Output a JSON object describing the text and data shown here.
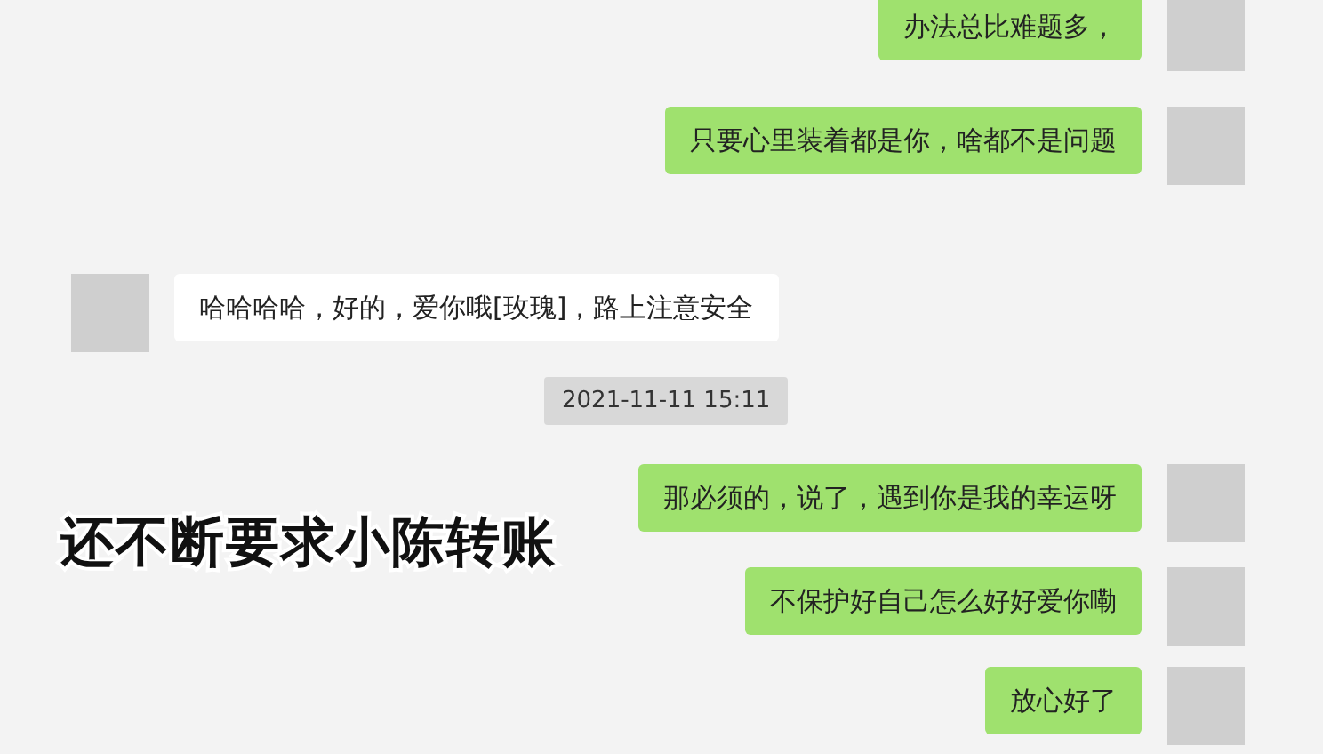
{
  "messages": [
    {
      "kind": "sent",
      "text": "办法总比难题多，"
    },
    {
      "kind": "sent",
      "text": "只要心里装着都是你，啥都不是问题"
    },
    {
      "kind": "received",
      "text": "哈哈哈哈，好的，爱你哦[玫瑰]，路上注意安全"
    },
    {
      "kind": "time",
      "text": "2021-11-11 15:11"
    },
    {
      "kind": "sent",
      "text": "那必须的，说了，遇到你是我的幸运呀"
    },
    {
      "kind": "sent",
      "text": "不保护好自己怎么好好爱你嘞"
    },
    {
      "kind": "sent",
      "text": "放心好了"
    }
  ],
  "caption": {
    "text": "还不断要求小陈转账"
  }
}
